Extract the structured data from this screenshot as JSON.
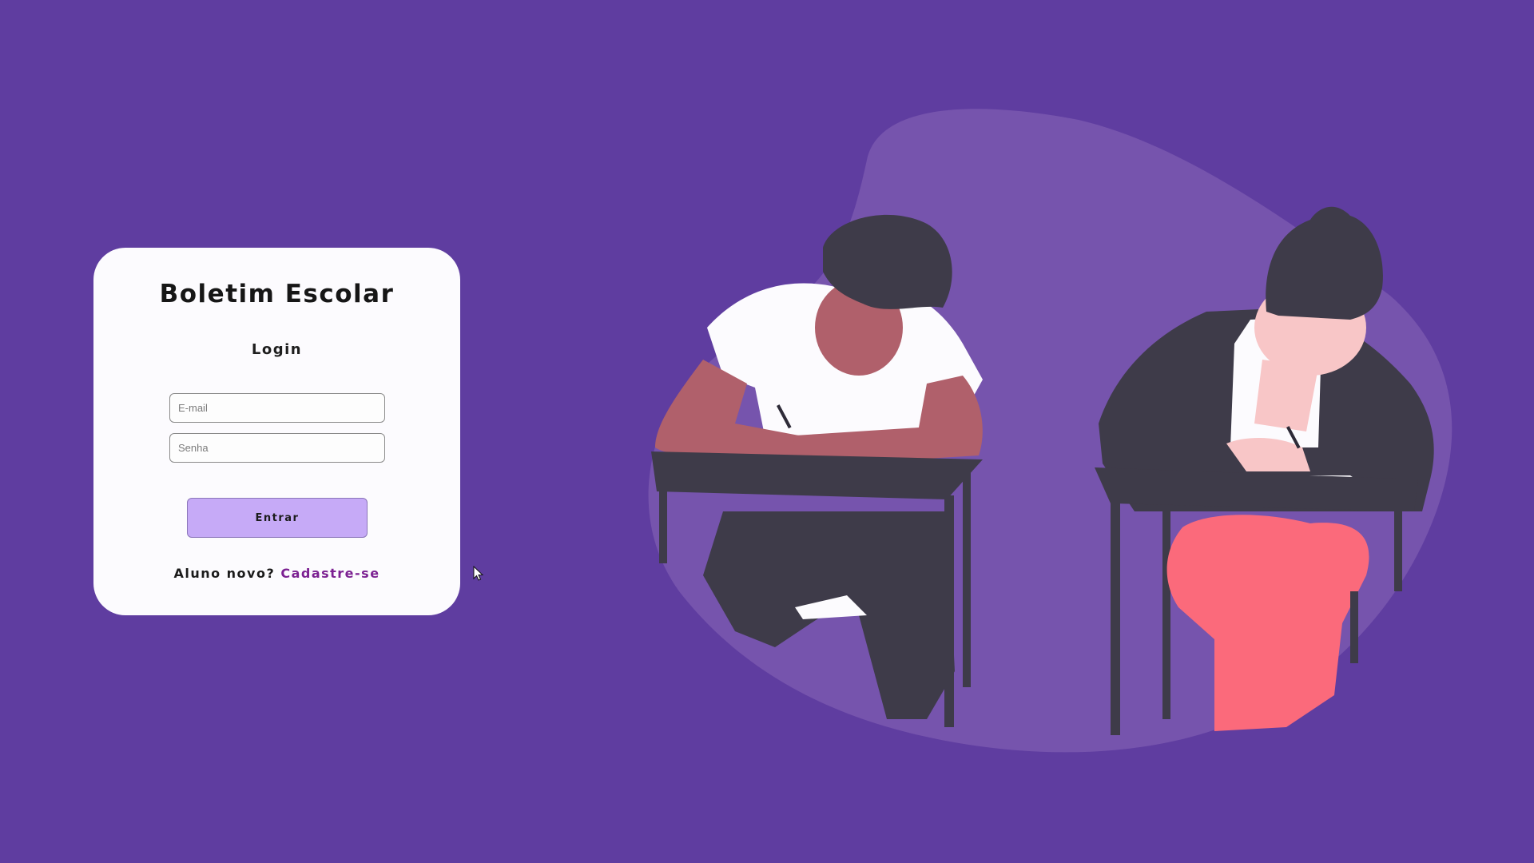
{
  "app": {
    "title": "Boletim Escolar",
    "subtitle": "Login"
  },
  "form": {
    "email_placeholder": "E-mail",
    "password_placeholder": "Senha",
    "submit_label": "Entrar"
  },
  "register": {
    "prompt": "Aluno novo?",
    "link_label": "Cadastre-se"
  },
  "colors": {
    "background": "#5f3da0",
    "card": "#fcfbfe",
    "button": "#c6aaf7",
    "link": "#7c2192"
  },
  "illustration": {
    "icon": "students-taking-exam-illustration"
  }
}
